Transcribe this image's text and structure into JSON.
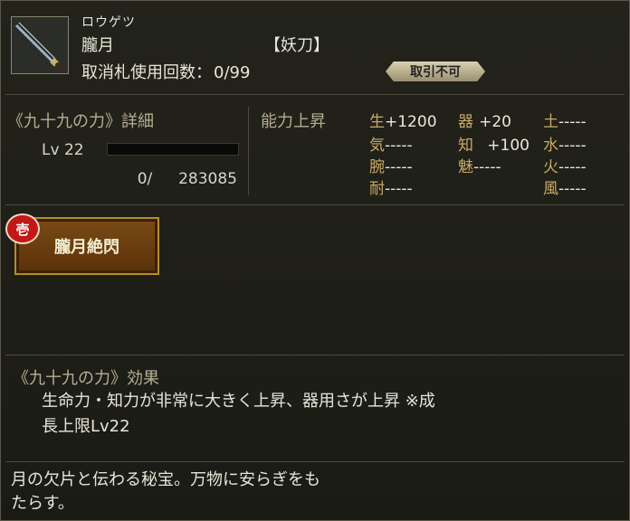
{
  "item": {
    "ruby": "ロウゲツ",
    "name": "朧月",
    "type_label": "【妖刀】",
    "usage_label": "取消札使用回数：",
    "usage_value": "0/99",
    "trade_badge": "取引不可"
  },
  "power": {
    "title": "《九十九の力》詳細",
    "level_label": "Lv",
    "level_value": "22",
    "exp_progress": 0,
    "exp_current": "0/",
    "exp_max": "283085"
  },
  "ability_up": {
    "title": "能力上昇",
    "stats": [
      {
        "key": "生",
        "value": "+1200"
      },
      {
        "key": "器",
        "value": "+20"
      },
      {
        "key": "土",
        "value": "-----"
      },
      {
        "key": "気",
        "value": "-----"
      },
      {
        "key": "知",
        "value": "+100"
      },
      {
        "key": "水",
        "value": "-----"
      },
      {
        "key": "腕",
        "value": "-----"
      },
      {
        "key": "魅",
        "value": "-----"
      },
      {
        "key": "火",
        "value": "-----"
      },
      {
        "key": "耐",
        "value": "-----"
      },
      {
        "key": "風",
        "value": "-----"
      }
    ]
  },
  "skill": {
    "badge": "壱",
    "label": "朧月絶閃"
  },
  "effect": {
    "title": "《九十九の力》効果",
    "line1": "生命力・知力が非常に大きく上昇、器用さが上昇 ※成",
    "line2": "長上限Lv22"
  },
  "flavor": {
    "line1": "月の欠片と伝わる秘宝。万物に安らぎをも",
    "line2": "たらす。"
  },
  "icons": {
    "item": "katana-icon"
  }
}
